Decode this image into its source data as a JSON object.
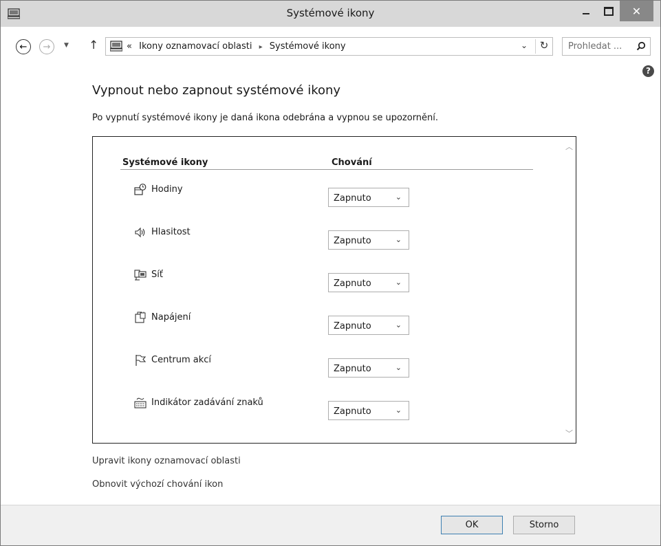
{
  "window": {
    "title": "Systémové ikony"
  },
  "nav": {
    "breadcrumb_prefix": "«",
    "breadcrumb": [
      "Ikony oznamovací oblasti",
      "Systémové ikony"
    ],
    "breadcrumb_separator": "▸",
    "search_placeholder": "Prohledat ..."
  },
  "main": {
    "heading": "Vypnout nebo zapnout systémové ikony",
    "description": "Po vypnutí systémové ikony je daná ikona odebrána a vypnou se upozornění.",
    "columns": {
      "icons": "Systémové ikony",
      "behavior": "Chování"
    },
    "rows": [
      {
        "label": "Hodiny",
        "icon": "clock-icon",
        "value": "Zapnuto"
      },
      {
        "label": "Hlasitost",
        "icon": "volume-icon",
        "value": "Zapnuto"
      },
      {
        "label": "Síť",
        "icon": "network-icon",
        "value": "Zapnuto"
      },
      {
        "label": "Napájení",
        "icon": "power-icon",
        "value": "Zapnuto"
      },
      {
        "label": "Centrum akcí",
        "icon": "flag-icon",
        "value": "Zapnuto"
      },
      {
        "label": "Indikátor zadávání znaků",
        "icon": "keyboard-icon",
        "value": "Zapnuto"
      }
    ],
    "links": [
      "Upravit ikony oznamovací oblasti",
      "Obnovit výchozí chování ikon"
    ]
  },
  "footer": {
    "ok_label": "OK",
    "cancel_label": "Storno"
  }
}
